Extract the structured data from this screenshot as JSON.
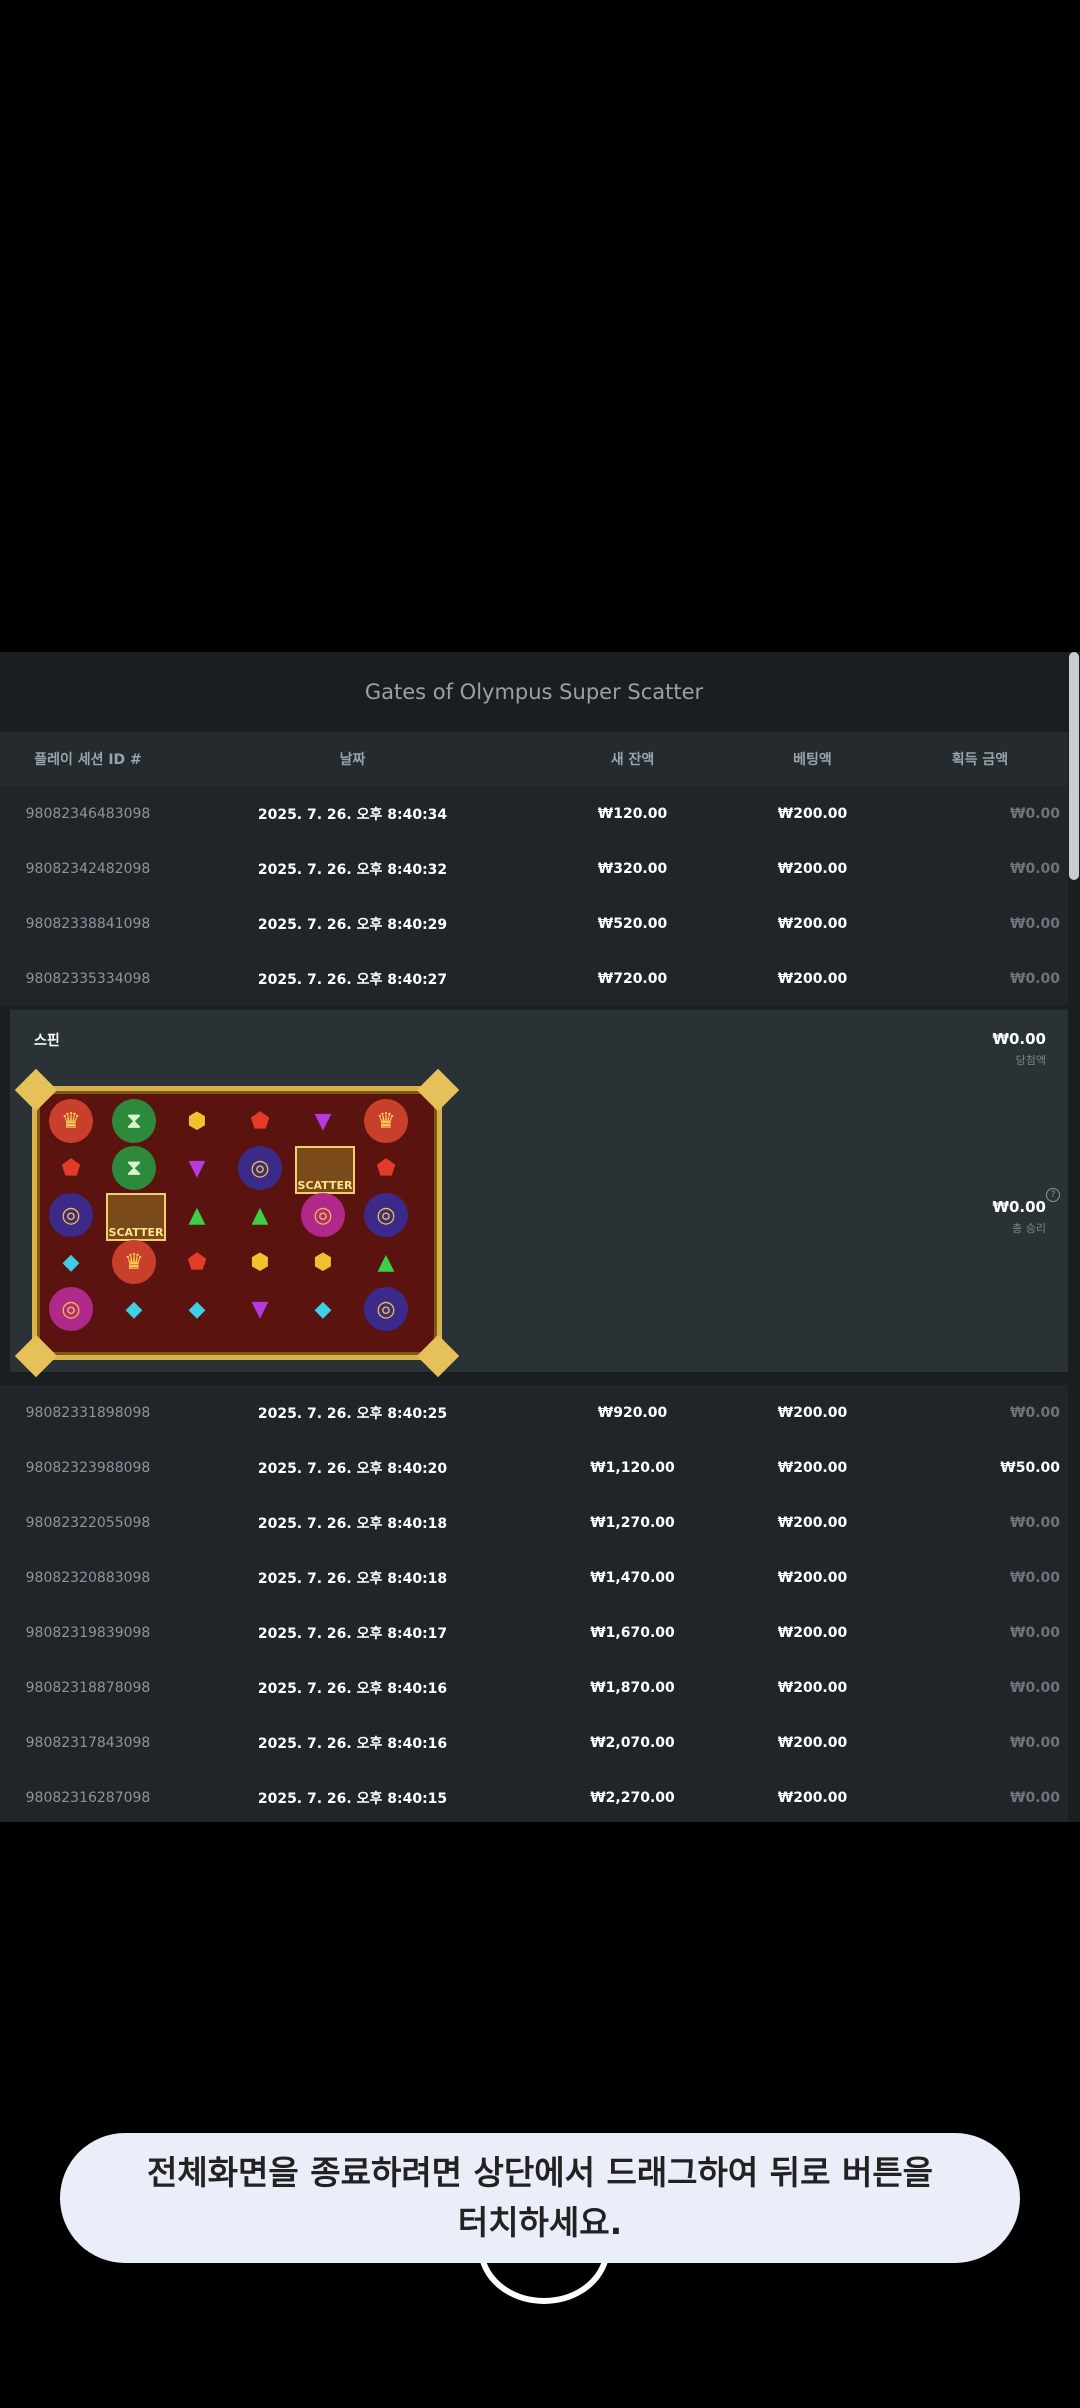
{
  "game_title": "Gates of Olympus Super Scatter",
  "columns": [
    "플레이 세션 ID #",
    "날짜",
    "새 잔액",
    "베팅액",
    "획득 금액"
  ],
  "rows_top": [
    {
      "id": "98082346483098",
      "date": "2025. 7. 26. 오후 8:40:34",
      "balance": "₩120.00",
      "bet": "₩200.00",
      "win": "₩0.00"
    },
    {
      "id": "98082342482098",
      "date": "2025. 7. 26. 오후 8:40:32",
      "balance": "₩320.00",
      "bet": "₩200.00",
      "win": "₩0.00"
    },
    {
      "id": "98082338841098",
      "date": "2025. 7. 26. 오후 8:40:29",
      "balance": "₩520.00",
      "bet": "₩200.00",
      "win": "₩0.00"
    },
    {
      "id": "98082335334098",
      "date": "2025. 7. 26. 오후 8:40:27",
      "balance": "₩720.00",
      "bet": "₩200.00",
      "win": "₩0.00"
    }
  ],
  "detail": {
    "spin_label": "스핀",
    "win_amount": "₩0.00",
    "win_label": "당첨액",
    "total_amount": "₩0.00",
    "total_label": "총 승리",
    "help_icon": "question-icon",
    "scatter_text": "SCATTER"
  },
  "rows_bottom": [
    {
      "id": "98082331898098",
      "date": "2025. 7. 26. 오후 8:40:25",
      "balance": "₩920.00",
      "bet": "₩200.00",
      "win": "₩0.00"
    },
    {
      "id": "98082323988098",
      "date": "2025. 7. 26. 오후 8:40:20",
      "balance": "₩1,120.00",
      "bet": "₩200.00",
      "win": "₩50.00"
    },
    {
      "id": "98082322055098",
      "date": "2025. 7. 26. 오후 8:40:18",
      "balance": "₩1,270.00",
      "bet": "₩200.00",
      "win": "₩0.00"
    },
    {
      "id": "98082320883098",
      "date": "2025. 7. 26. 오후 8:40:18",
      "balance": "₩1,470.00",
      "bet": "₩200.00",
      "win": "₩0.00"
    },
    {
      "id": "98082319839098",
      "date": "2025. 7. 26. 오후 8:40:17",
      "balance": "₩1,670.00",
      "bet": "₩200.00",
      "win": "₩0.00"
    },
    {
      "id": "98082318878098",
      "date": "2025. 7. 26. 오후 8:40:16",
      "balance": "₩1,870.00",
      "bet": "₩200.00",
      "win": "₩0.00"
    },
    {
      "id": "98082317843098",
      "date": "2025. 7. 26. 오후 8:40:16",
      "balance": "₩2,070.00",
      "bet": "₩200.00",
      "win": "₩0.00"
    },
    {
      "id": "98082316287098",
      "date": "2025. 7. 26. 오후 8:40:15",
      "balance": "₩2,270.00",
      "bet": "₩200.00",
      "win": "₩0.00"
    }
  ],
  "toast": {
    "line1": "전체화면을 종료하려면 상단에서 드래그하여 뒤로 버튼을",
    "line2": "터치하세요."
  }
}
